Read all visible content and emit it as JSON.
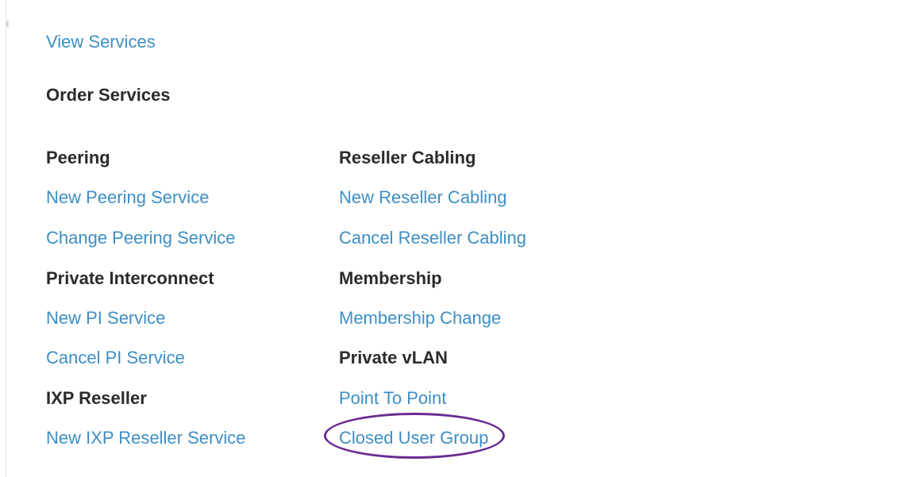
{
  "view_services": "View Services",
  "order_services": "Order Services",
  "left_column": {
    "peering_heading": "Peering",
    "new_peering": "New Peering Service",
    "change_peering": "Change Peering Service",
    "pi_heading": "Private Interconnect",
    "new_pi": "New PI Service",
    "cancel_pi": "Cancel PI Service",
    "ixp_heading": "IXP Reseller",
    "new_ixp": "New IXP Reseller Service"
  },
  "right_column": {
    "reseller_cabling_heading": "Reseller Cabling",
    "new_reseller_cabling": "New Reseller Cabling",
    "cancel_reseller_cabling": "Cancel Reseller Cabling",
    "membership_heading": "Membership",
    "membership_change": "Membership Change",
    "private_vlan_heading": "Private vLAN",
    "point_to_point": "Point To Point",
    "closed_user_group": "Closed User Group"
  },
  "colors": {
    "link": "#3d8ec5",
    "heading": "#2b2b2b",
    "highlight_ring": "#6a2c91"
  }
}
